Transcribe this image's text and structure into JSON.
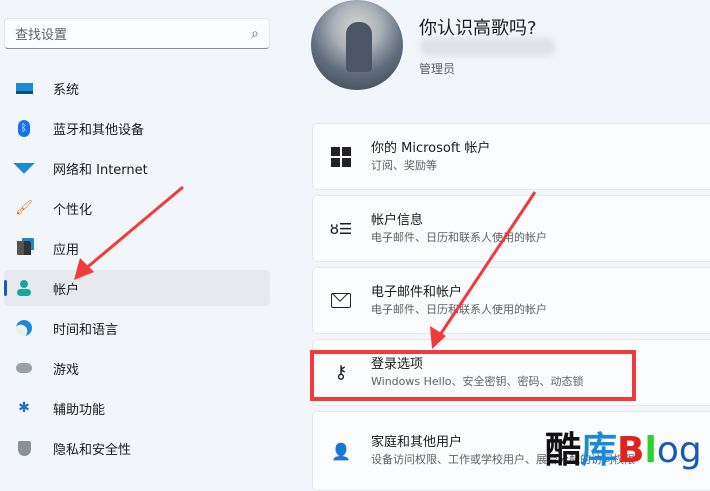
{
  "search": {
    "placeholder": "查找设置",
    "icon": "search-icon"
  },
  "sidebar": {
    "items": [
      {
        "label": "系统",
        "icon": "system-icon"
      },
      {
        "label": "蓝牙和其他设备",
        "icon": "bluetooth-icon"
      },
      {
        "label": "网络和 Internet",
        "icon": "wifi-icon"
      },
      {
        "label": "个性化",
        "icon": "brush-icon"
      },
      {
        "label": "应用",
        "icon": "apps-icon"
      },
      {
        "label": "帐户",
        "icon": "person-icon",
        "active": true
      },
      {
        "label": "时间和语言",
        "icon": "time-language-icon"
      },
      {
        "label": "游戏",
        "icon": "gamepad-icon"
      },
      {
        "label": "辅助功能",
        "icon": "accessibility-icon"
      },
      {
        "label": "隐私和安全性",
        "icon": "shield-icon"
      }
    ]
  },
  "profile": {
    "name": "你认识高歌吗?",
    "role": "管理员"
  },
  "cards": [
    {
      "title": "你的 Microsoft 帐户",
      "subtitle": "订阅、奖励等",
      "icon": "windows-logo-icon"
    },
    {
      "title": "帐户信息",
      "subtitle": "电子邮件、日历和联系人使用的帐户",
      "icon": "person-list-icon"
    },
    {
      "title": "电子邮件和帐户",
      "subtitle": "电子邮件、日历和联系人使用的帐户",
      "icon": "mail-icon"
    },
    {
      "title": "登录选项",
      "subtitle": "Windows Hello、安全密钥、密码、动态锁",
      "icon": "key-icon"
    },
    {
      "title": "家庭和其他用户",
      "subtitle": "设备访问权限、工作或学校用户、展台分配的访问权限",
      "icon": "person-add-icon"
    }
  ],
  "watermark": {
    "text1": "酷",
    "text2": "库",
    "text3": "B",
    "text4": "l",
    "text5": "og"
  },
  "colors": {
    "accent": "#1a5fb4",
    "highlight": "#f23a3a"
  }
}
